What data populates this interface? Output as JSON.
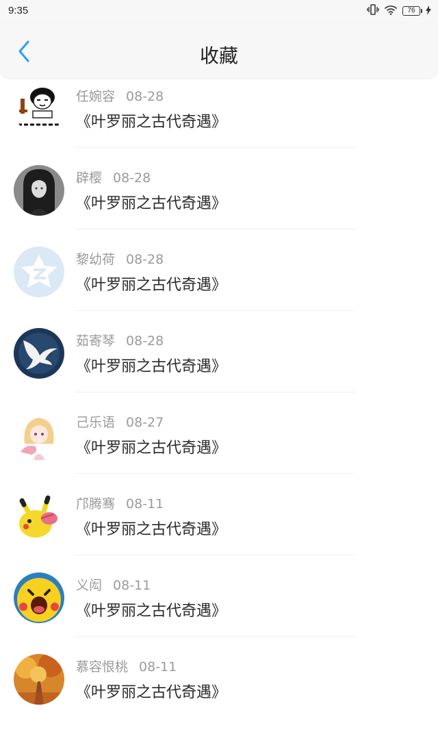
{
  "status_bar": {
    "time": "9:35",
    "battery": "76",
    "icons": [
      "vibrate-icon",
      "wifi-icon",
      "battery-icon",
      "charging-icon"
    ]
  },
  "header": {
    "title": "收藏",
    "back_icon": "chevron-left-icon",
    "accent_color": "#2a9df4"
  },
  "favorites": [
    {
      "user": "任婉容",
      "date": "08-28",
      "book": "《叶罗丽之古代奇遇》",
      "avatar": "meme-avatar"
    },
    {
      "user": "辟樱",
      "date": "08-28",
      "book": "《叶罗丽之古代奇遇》",
      "avatar": "girl-portrait-avatar"
    },
    {
      "user": "黎幼荷",
      "date": "08-28",
      "book": "《叶罗丽之古代奇遇》",
      "avatar": "qzone-default-avatar"
    },
    {
      "user": "茹寄琴",
      "date": "08-28",
      "book": "《叶罗丽之古代奇遇》",
      "avatar": "dove-avatar"
    },
    {
      "user": "己乐语",
      "date": "08-27",
      "book": "《叶罗丽之古代奇遇》",
      "avatar": "anime-girl-avatar"
    },
    {
      "user": "邝腾骞",
      "date": "08-11",
      "book": "《叶罗丽之古代奇遇》",
      "avatar": "pikachu-avatar"
    },
    {
      "user": "义闳",
      "date": "08-11",
      "book": "《叶罗丽之古代奇遇》",
      "avatar": "pikachu-face-avatar"
    },
    {
      "user": "慕容恨桃",
      "date": "08-11",
      "book": "《叶罗丽之古代奇遇》",
      "avatar": "autumn-road-avatar"
    }
  ]
}
